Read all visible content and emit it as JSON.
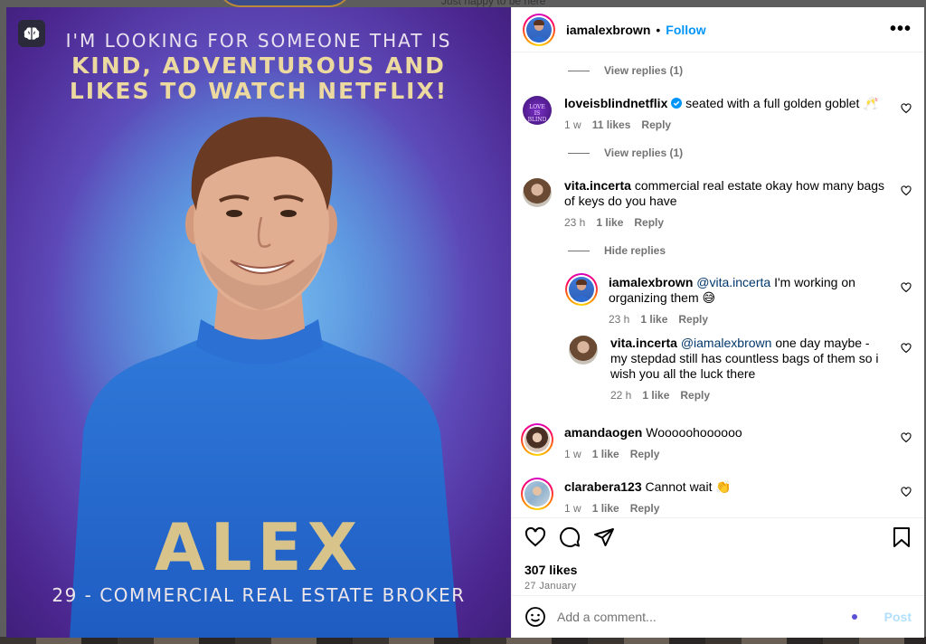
{
  "background": {
    "top_text": "Just happy to be here"
  },
  "media": {
    "headline_line1": "I'M LOOKING FOR SOMEONE THAT IS",
    "headline_line2": "KIND, ADVENTUROUS AND",
    "headline_line3": "LIKES TO WATCH NETFLIX!",
    "name": "ALEX",
    "subtitle": "29 - COMMERCIAL REAL ESTATE BROKER"
  },
  "post_header": {
    "username": "iamalexbrown",
    "dot": "•",
    "follow_label": "Follow",
    "more_label": "•••"
  },
  "comments": {
    "view_replies_1": "View replies (1)",
    "view_replies_2": "View replies (1)",
    "hide_replies": "Hide replies",
    "items": [
      {
        "username": "loveisblindnetflix",
        "verified": true,
        "text": "seated with a full golden goblet 🥂",
        "time": "1 w",
        "likes": "11 likes",
        "reply_label": "Reply"
      },
      {
        "username": "vita.incerta",
        "text": "commercial real estate okay how many bags of keys do you have",
        "time": "23 h",
        "likes": "1 like",
        "reply_label": "Reply"
      },
      {
        "username": "iamalexbrown",
        "mention": "@vita.incerta",
        "text": "I'm working on organizing them 😅",
        "time": "23 h",
        "likes": "1 like",
        "reply_label": "Reply"
      },
      {
        "username": "vita.incerta",
        "mention": "@iamalexbrown",
        "text": "one day maybe - my stepdad still has countless bags of them so i wish you all the luck there",
        "time": "22 h",
        "likes": "1 like",
        "reply_label": "Reply"
      },
      {
        "username": "amandaogen",
        "text": "Wooooohoooooo",
        "time": "1 w",
        "likes": "1 like",
        "reply_label": "Reply"
      },
      {
        "username": "clarabera123",
        "text": "Cannot wait 👏",
        "time": "1 w",
        "likes": "1 like",
        "reply_label": "Reply"
      }
    ]
  },
  "actions": {
    "likes_count": "307 likes",
    "date": "27 January"
  },
  "add_comment": {
    "placeholder": "Add a comment...",
    "post_label": "Post"
  },
  "icons": {
    "logo": "netflix-brain-icon",
    "like": "heart-icon",
    "comment": "comment-icon",
    "share": "share-icon",
    "save": "bookmark-icon",
    "emoji": "emoji-icon",
    "more": "more-icon"
  },
  "colors": {
    "link_blue": "#0095f6",
    "muted": "#737373",
    "mention": "#00376b",
    "gold": "#d8c48a"
  }
}
